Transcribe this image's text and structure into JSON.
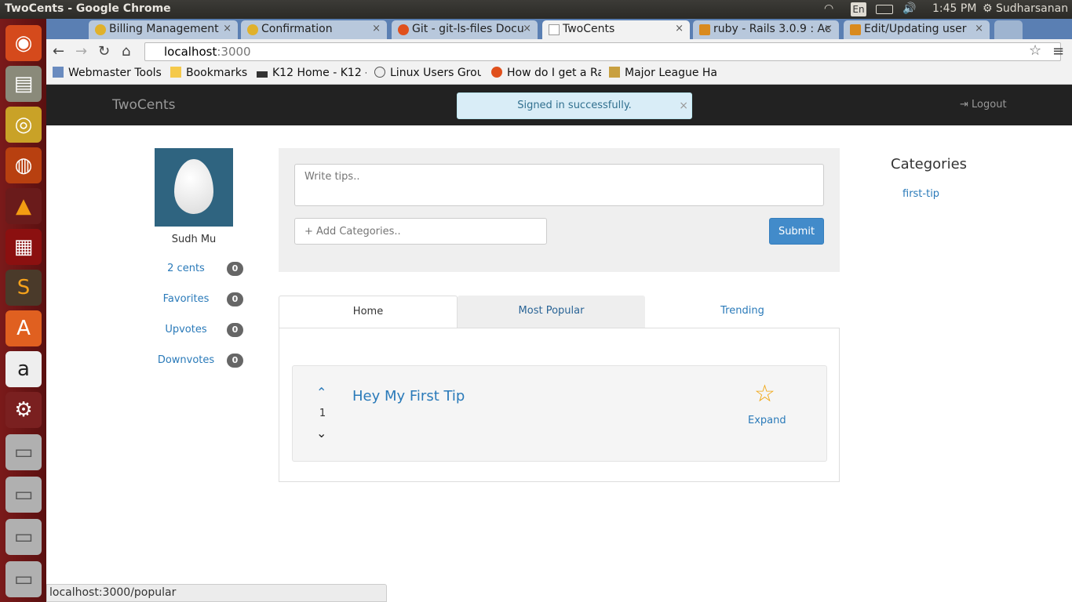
{
  "os": {
    "window_title": "TwoCents - Google Chrome",
    "lang": "En",
    "clock": "1:45 PM",
    "user": "Sudharsanan"
  },
  "browser": {
    "tabs": [
      {
        "title": "Billing Management",
        "active": false
      },
      {
        "title": "Confirmation",
        "active": false
      },
      {
        "title": "Git - git-ls-files Docu",
        "active": false
      },
      {
        "title": "TwoCents",
        "active": true
      },
      {
        "title": "ruby - Rails 3.0.9 : Ac",
        "active": false
      },
      {
        "title": "Edit/Updating user",
        "active": false
      }
    ],
    "url_host": "localhost",
    "url_port": ":3000",
    "bookmarks": [
      "Webmaster Tools",
      "Bookmarks",
      "K12 Home - K12 - ",
      "Linux Users Grou",
      "How do I get a Ra",
      "Major League Ha"
    ],
    "status_url": "localhost:3000/popular"
  },
  "app": {
    "brand": "TwoCents",
    "flash": "Signed in successfully.",
    "flash_close": "×",
    "logout": "Logout",
    "profile": {
      "name": "Sudh Mu",
      "stats": [
        {
          "label": "2 cents",
          "count": "0"
        },
        {
          "label": "Favorites",
          "count": "0"
        },
        {
          "label": "Upvotes",
          "count": "0"
        },
        {
          "label": "Downvotes",
          "count": "0"
        }
      ]
    },
    "form": {
      "tip_placeholder": "Write tips..",
      "category_placeholder": "+ Add Categories..",
      "submit": "Submit"
    },
    "tabs": {
      "home": "Home",
      "popular": "Most Popular",
      "trending": "Trending"
    },
    "tip": {
      "votes": "1",
      "title": "Hey My First Tip",
      "expand": "Expand"
    },
    "categories": {
      "heading": "Categories",
      "items": [
        "first-tip"
      ]
    }
  },
  "colors": {
    "accent": "#428bca",
    "navbar": "#222222",
    "flash_bg": "#d9edf7",
    "star": "#f0a30a"
  },
  "icons": [
    "ubuntu-icon",
    "files-icon",
    "chrome-icon",
    "firefox-icon",
    "vlc-icon",
    "terminal-icon",
    "sublime-icon",
    "software-center-icon",
    "amazon-icon",
    "settings-icon",
    "drive-icon",
    "star-icon",
    "chevron-up-icon",
    "chevron-down-icon",
    "logout-icon"
  ]
}
